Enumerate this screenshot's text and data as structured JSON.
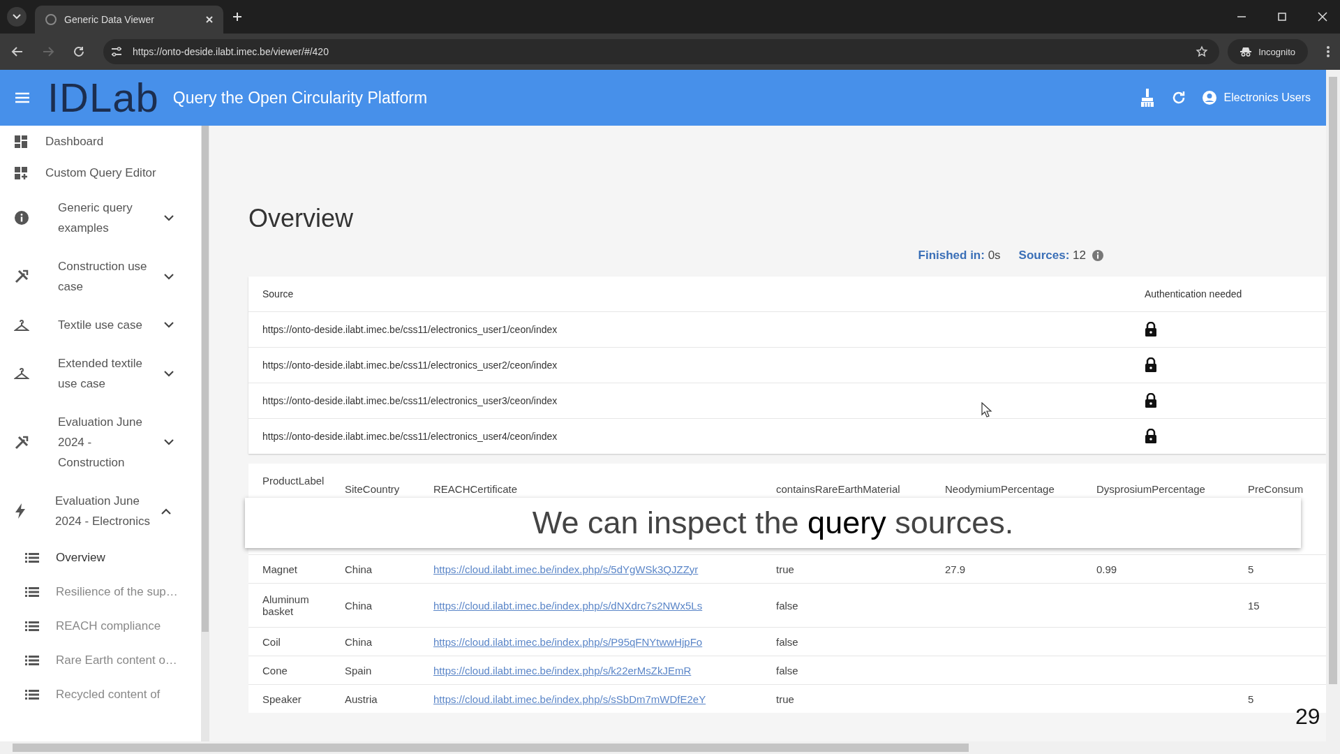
{
  "browser": {
    "tab_title": "Generic Data Viewer",
    "url": "https://onto-deside.ilabt.imec.be/viewer/#/420",
    "incognito_label": "Incognito"
  },
  "header": {
    "logo": "IDLab",
    "title": "Query the Open Circularity Platform",
    "user": "Electronics Users"
  },
  "sidebar": {
    "items": [
      {
        "kind": "link",
        "label": "Dashboard"
      },
      {
        "kind": "link",
        "label": "Custom Query Editor"
      },
      {
        "kind": "group",
        "label": "Generic query examples",
        "expanded": false
      },
      {
        "kind": "group",
        "label": "Construction use case",
        "expanded": false
      },
      {
        "kind": "group",
        "label": "Textile use case",
        "expanded": false
      },
      {
        "kind": "group",
        "label": "Extended textile use case",
        "expanded": false
      },
      {
        "kind": "group",
        "label": "Evaluation June 2024 - Construction",
        "expanded": false
      },
      {
        "kind": "group",
        "label": "Evaluation June 2024 - Electronics",
        "expanded": true,
        "children": [
          {
            "label": "Overview",
            "selected": true
          },
          {
            "label": "Resilience of the sup…",
            "selected": false
          },
          {
            "label": "REACH compliance",
            "selected": false
          },
          {
            "label": "Rare Earth content o…",
            "selected": false
          },
          {
            "label": "Recycled content of",
            "selected": false
          }
        ]
      }
    ]
  },
  "page": {
    "title": "Overview",
    "finished_label": "Finished in:",
    "finished_value": "0s",
    "sources_label": "Sources:",
    "sources_value": "12"
  },
  "sources_table": {
    "columns": [
      "Source",
      "Authentication needed"
    ],
    "rows": [
      {
        "source": "https://onto-deside.ilabt.imec.be/css11/electronics_user1/ceon/index",
        "auth_needed": true
      },
      {
        "source": "https://onto-deside.ilabt.imec.be/css11/electronics_user2/ceon/index",
        "auth_needed": true
      },
      {
        "source": "https://onto-deside.ilabt.imec.be/css11/electronics_user3/ceon/index",
        "auth_needed": true
      },
      {
        "source": "https://onto-deside.ilabt.imec.be/css11/electronics_user4/ceon/index",
        "auth_needed": true
      }
    ]
  },
  "results_table": {
    "columns": [
      "ProductLabel",
      "SiteCountry",
      "REACHCertificate",
      "containsRareEarthMaterial",
      "NeodymiumPercentage",
      "DysprosiumPercentage",
      "PreConsum"
    ],
    "rows": [
      [
        "Magnet",
        "China",
        "https://cloud.ilabt.imec.be/index.php/s/5dYgWSk3QJZZyr",
        "true",
        "27.9",
        "0.99",
        "5"
      ],
      [
        "Aluminum basket",
        "China",
        "https://cloud.ilabt.imec.be/index.php/s/dNXdrc7s2NWx5Ls",
        "false",
        "",
        "",
        "15"
      ],
      [
        "Coil",
        "China",
        "https://cloud.ilabt.imec.be/index.php/s/P95qFNYtwwHjpFo",
        "false",
        "",
        "",
        ""
      ],
      [
        "Cone",
        "Spain",
        "https://cloud.ilabt.imec.be/index.php/s/k22erMsZkJEmR",
        "false",
        "",
        "",
        ""
      ],
      [
        "Speaker",
        "Austria",
        "https://cloud.ilabt.imec.be/index.php/s/sSbDm7mWDfE2eY",
        "true",
        "",
        "",
        "5"
      ]
    ]
  },
  "caption": "We can inspect the **query** sources.",
  "slide_number": "29"
}
